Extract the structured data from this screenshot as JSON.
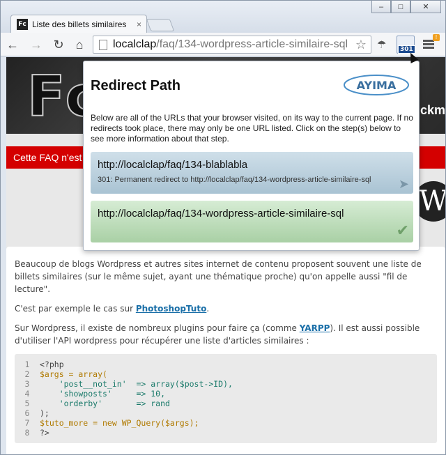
{
  "browser": {
    "tab_title": "Liste des billets similaires",
    "tab_close": "×",
    "favicon_text": "Fc",
    "url_host": "localclap",
    "url_path": "/faq/134-wordpress-article-similaire-sql",
    "extension_badge": "301",
    "menu_alert": "!"
  },
  "page": {
    "hero_text": "Fc",
    "hero_right_text": "ckm",
    "red_bar_text": "Cette FAQ n'est",
    "wp_logo": "W",
    "paragraph1": "Beaucoup de blogs Wordpress et autres sites internet de contenu proposent souvent une liste de billets similaires (sur le même sujet, ayant une thématique proche) qu'on appelle aussi \"fil de lecture\".",
    "paragraph2_before": "C'est par exemple le cas sur ",
    "paragraph2_link": "PhotoshopTuto",
    "paragraph2_after": ".",
    "paragraph3_before": "Sur Wordpress, il existe de nombreux plugins pour faire ça (comme ",
    "paragraph3_link": "YARPP",
    "paragraph3_after": "). Il est aussi possible d'utiliser l'API wordpress pour récupérer une liste d'articles similaires :",
    "code_lines": [
      {
        "n": "1",
        "text": "<?php"
      },
      {
        "n": "2",
        "text": "$args = array("
      },
      {
        "n": "3",
        "text": "    'post__not_in'  => array($post->ID),"
      },
      {
        "n": "4",
        "text": "    'showposts'     => 10,"
      },
      {
        "n": "5",
        "text": "    'orderby'       => rand"
      },
      {
        "n": "6",
        "text": ");"
      },
      {
        "n": "7",
        "text": "$tuto_more = new WP_Query($args);"
      },
      {
        "n": "8",
        "text": "?>"
      }
    ]
  },
  "popup": {
    "title": "Redirect Path",
    "logo_text": "AYIMA",
    "description": "Below are all of the URLs that your browser visited, on its way to the current page. If no redirects took place, there may only be one URL listed. Click on the step(s) below to see more information about that step.",
    "steps": [
      {
        "url": "http://localclap/faq/134-blablabla",
        "status": "301: Permanent redirect to http://localclap/faq/134-wordpress-article-similaire-sql"
      },
      {
        "url": "http://localclap/faq/134-wordpress-article-similaire-sql",
        "status": ""
      }
    ]
  }
}
